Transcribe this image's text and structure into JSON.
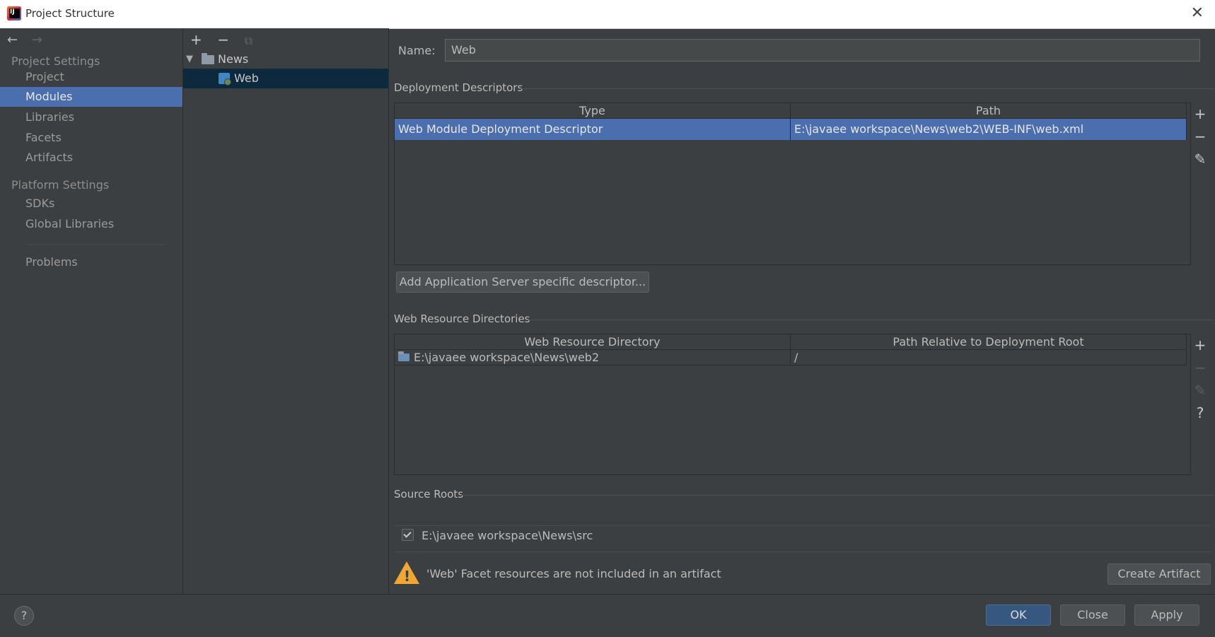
{
  "window": {
    "title": "Project Structure",
    "close_glyph": "✕"
  },
  "sidebar": {
    "back": "←",
    "forward": "→",
    "project_settings_header": "Project Settings",
    "platform_settings_header": "Platform Settings",
    "items": {
      "project": "Project",
      "modules": "Modules",
      "libraries": "Libraries",
      "facets": "Facets",
      "artifacts": "Artifacts",
      "sdks": "SDKs",
      "global_libraries": "Global Libraries",
      "problems": "Problems"
    },
    "active_item": "Modules"
  },
  "tree": {
    "add": "+",
    "remove": "−",
    "copy": "⧉",
    "root": {
      "label": "News",
      "expanded": true
    },
    "child": {
      "label": "Web",
      "selected": true
    }
  },
  "main": {
    "name_label": "Name:",
    "name_value": "Web",
    "deployment_descriptors": {
      "title": "Deployment Descriptors",
      "columns": [
        "Type",
        "Path"
      ],
      "rows": [
        {
          "type": "Web Module Deployment Descriptor",
          "path": "E:\\javaee workspace\\News\\web2\\WEB-INF\\web.xml"
        }
      ],
      "add_server_button": "Add Application Server specific descriptor..."
    },
    "web_resource_dirs": {
      "title": "Web Resource Directories",
      "columns": [
        "Web Resource Directory",
        "Path Relative to Deployment Root"
      ],
      "rows": [
        {
          "dir": "E:\\javaee workspace\\News\\web2",
          "rel": "/"
        }
      ]
    },
    "source_roots": {
      "title": "Source Roots",
      "items": [
        {
          "path": "E:\\javaee workspace\\News\\src",
          "checked": true
        }
      ]
    },
    "warning": {
      "text": "'Web' Facet resources are not included in an artifact",
      "button": "Create Artifact"
    },
    "table_tools": {
      "add": "+",
      "remove": "−",
      "edit": "✎",
      "help": "?"
    }
  },
  "footer": {
    "help": "?",
    "ok": "OK",
    "close": "Close",
    "apply": "Apply"
  },
  "colors": {
    "background": "#3c3f41",
    "selection": "#4b6eaf",
    "primary_button": "#365880",
    "warning": "#f0a732"
  }
}
